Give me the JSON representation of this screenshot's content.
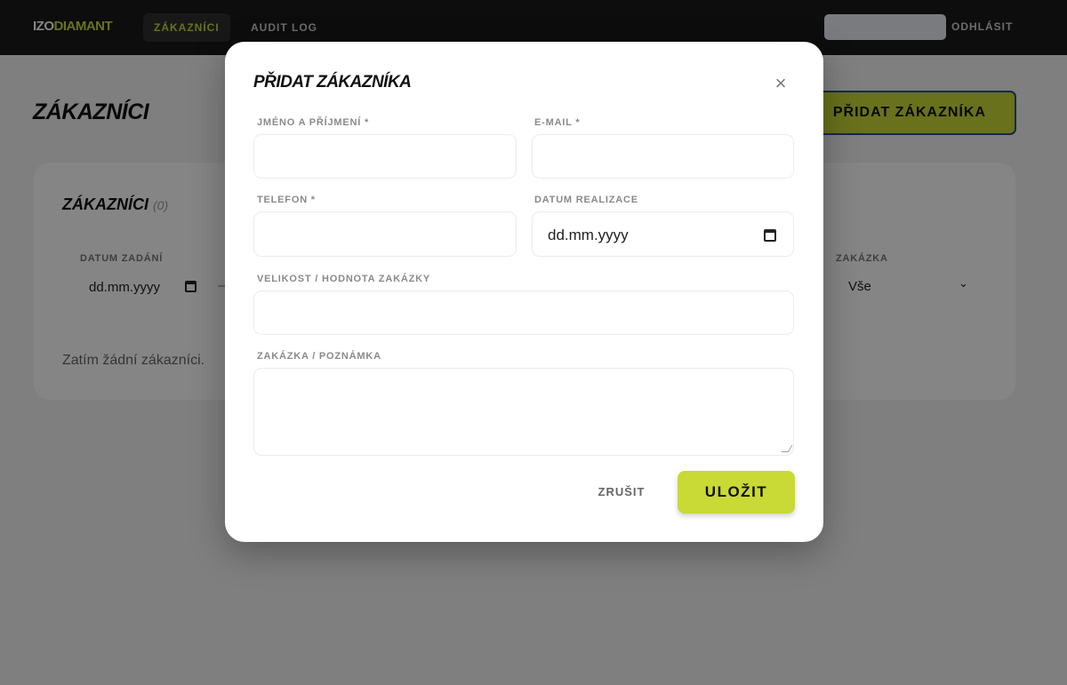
{
  "app": {
    "logo_part1": "IZO",
    "logo_part2": "DIAMANT",
    "accent_color": "#c9d936"
  },
  "nav": {
    "tabs": [
      {
        "label": "ZÁKAZNÍCI",
        "active": true
      },
      {
        "label": "AUDIT LOG",
        "active": false
      }
    ],
    "logout_label": "ODHLÁSIT"
  },
  "page": {
    "title": "ZÁKAZNÍCI",
    "add_button_label": "PŘIDAT ZÁKAZNÍKA",
    "card": {
      "title": "ZÁKAZNÍCI",
      "count": "(0)",
      "filters": {
        "date_label": "DATUM ZADÁNÍ",
        "date_value": "dd.mm.yyyy",
        "range_separator": "–",
        "order_label": "ZAKÁZKA",
        "order_value": "Vše"
      },
      "empty_text": "Zatím žádní zákazníci."
    }
  },
  "modal": {
    "title": "PŘIDAT ZÁKAZNÍKA",
    "close_icon": "close-icon",
    "fields": {
      "name_label": "JMÉNO A PŘÍJMENÍ *",
      "email_label": "E-MAIL *",
      "phone_label": "TELEFON *",
      "date_label": "DATUM REALIZACE",
      "date_value": "dd.mm.yyyy",
      "size_label": "VELIKOST / HODNOTA ZAKÁZKY",
      "note_label": "ZAKÁZKA / POZNÁMKA"
    },
    "cancel_label": "ZRUŠIT",
    "save_label": "ULOŽIT"
  }
}
